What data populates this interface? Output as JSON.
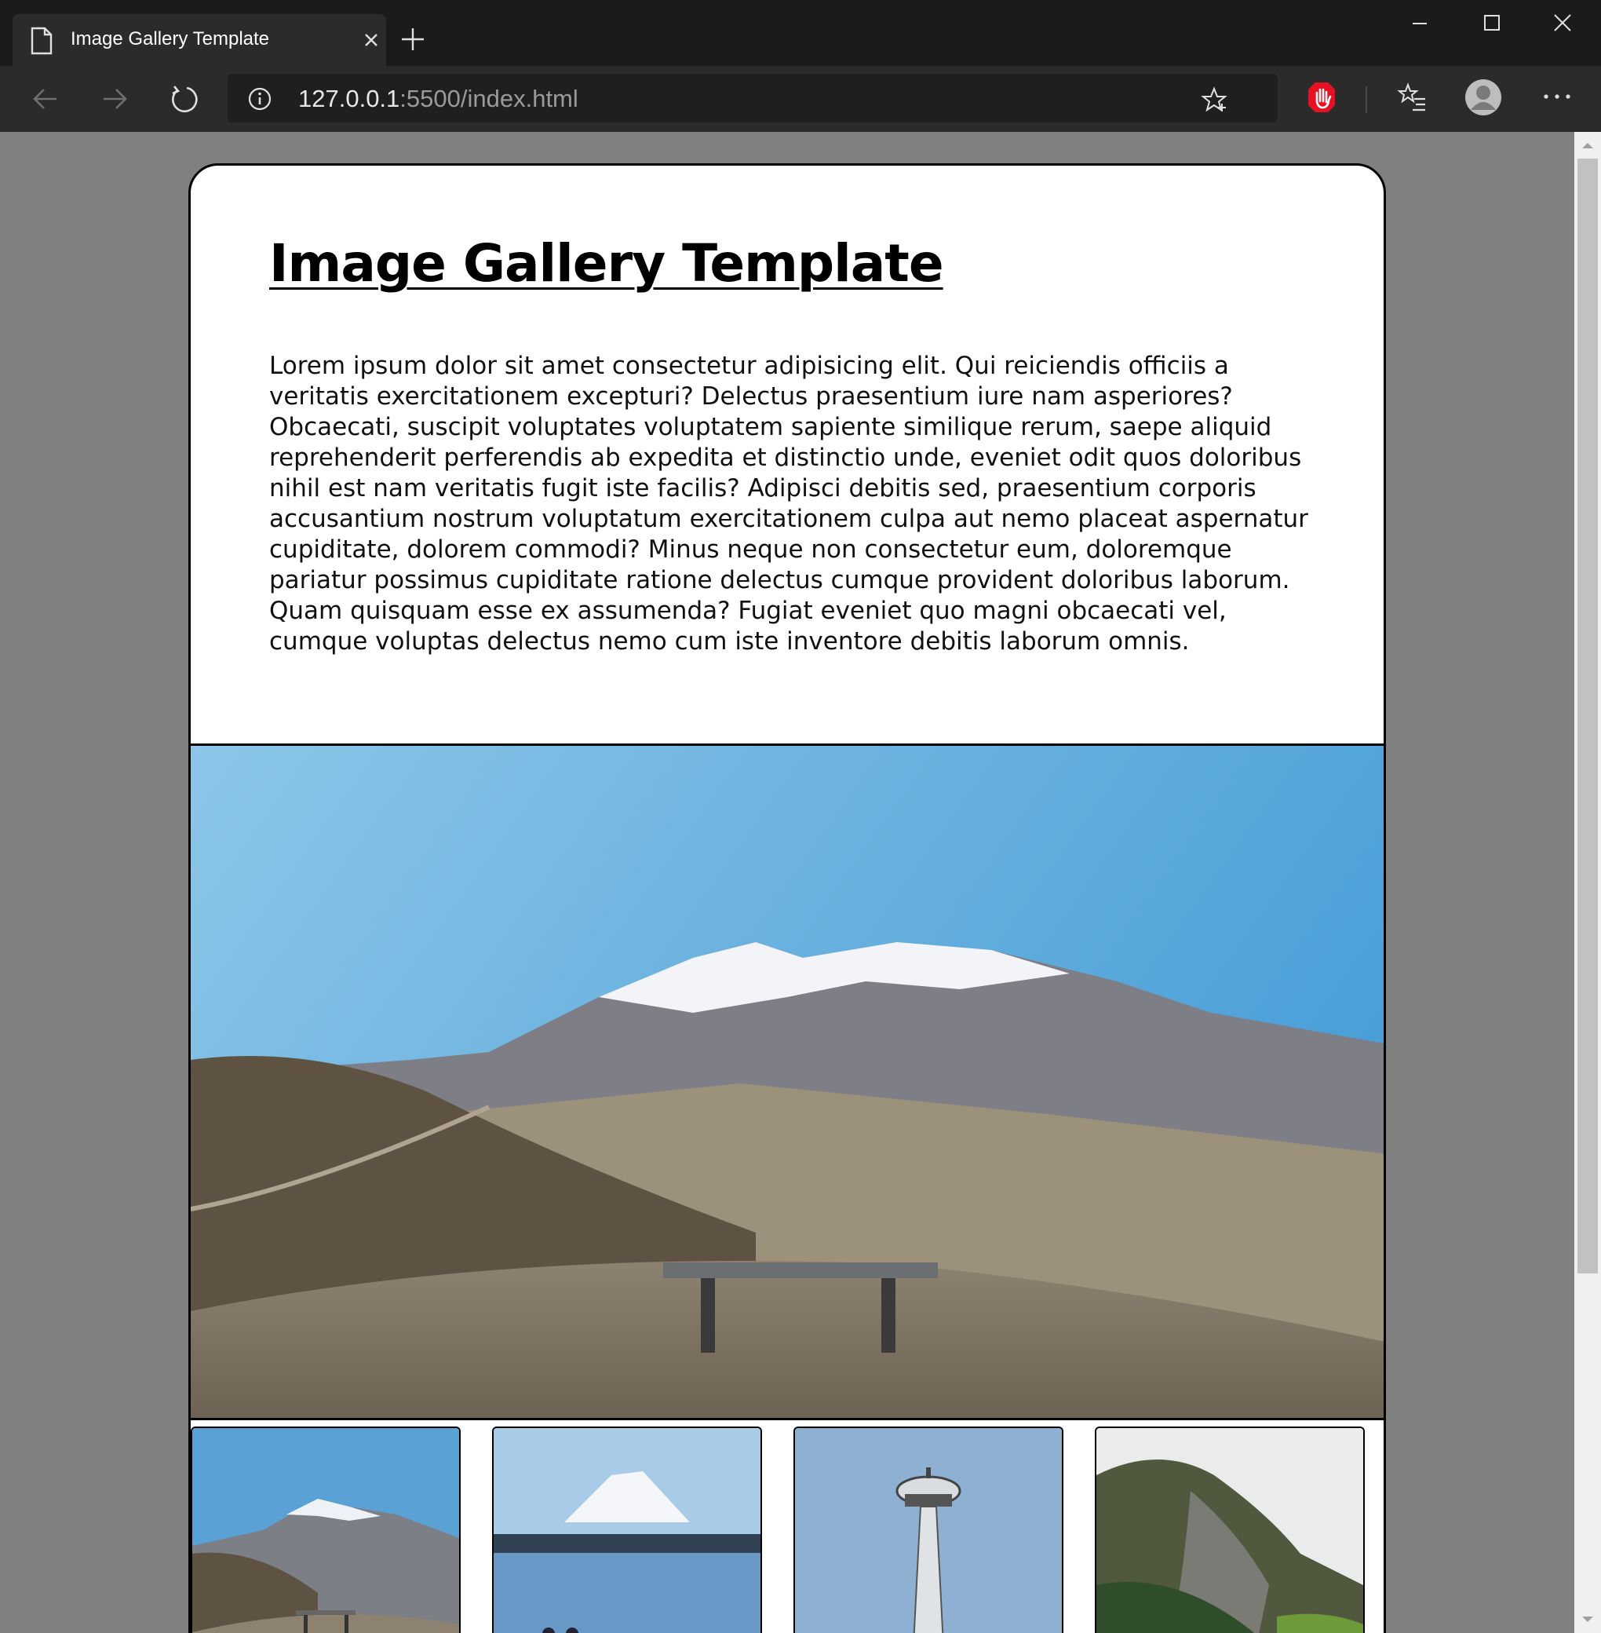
{
  "browser": {
    "tab_title": "Image Gallery Template",
    "url_host": "127.0.0.1",
    "url_rest": ":5500/index.html"
  },
  "page": {
    "heading": "Image Gallery Template",
    "paragraph": "Lorem ipsum dolor sit amet consectetur adipisicing elit. Qui reiciendis officiis a veritatis exercitationem excepturi? Delectus praesentium iure nam asperiores? Obcaecati, suscipit voluptates voluptatem sapiente similique rerum, saepe aliquid reprehenderit perferendis ab expedita et distinctio unde, eveniet odit quos doloribus nihil est nam veritatis fugit iste facilis? Adipisci debitis sed, praesentium corporis accusantium nostrum voluptatum exercitationem culpa aut nemo placeat aspernatur cupiditate, dolorem commodi? Minus neque non consectetur eum, doloremque pariatur possimus cupiditate ratione delectus cumque provident doloribus laborum. Quam quisquam esse ex assumenda? Fugiat eveniet quo magni obcaecati vel, cumque voluptas delectus nemo cum iste inventore debitis laborum omnis."
  },
  "icons": {
    "tab": "document-icon",
    "extension": "ad-block-hand-icon",
    "ext_color": "#e81123"
  }
}
